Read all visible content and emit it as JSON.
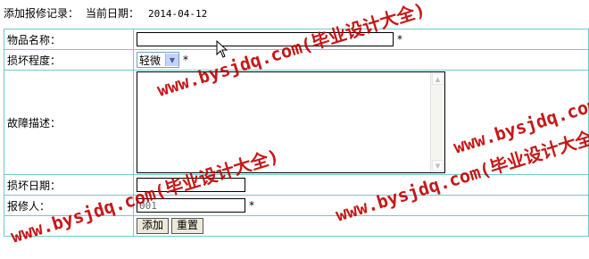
{
  "header": {
    "label": "添加报修记录：",
    "date_label": "当前日期：",
    "date": "2014-04-12"
  },
  "form": {
    "name": {
      "label": "物品名称：",
      "value": "",
      "required": "*"
    },
    "damage": {
      "label": "损坏程度：",
      "selected": "轻微",
      "required": "*"
    },
    "description": {
      "label": "故障描述：",
      "value": ""
    },
    "damage_date": {
      "label": "损坏日期：",
      "value": ""
    },
    "reporter": {
      "label": "报修人：",
      "value": "001",
      "required": "*"
    },
    "buttons": {
      "add": "添加",
      "reset": "重置"
    }
  },
  "watermark": {
    "text1": "www.bysjdq.com(毕业设计大全)",
    "text2": "www.bysjdq.com(毕业设计大全)",
    "text3": "www.bysjdq.com(毕业设计大全)",
    "text4": "www.bysjdq.com(毕业设计大全)",
    "color": "#c00000"
  },
  "colors": {
    "table_border": "#72c9d1",
    "button_bg": "#ece9d8"
  }
}
